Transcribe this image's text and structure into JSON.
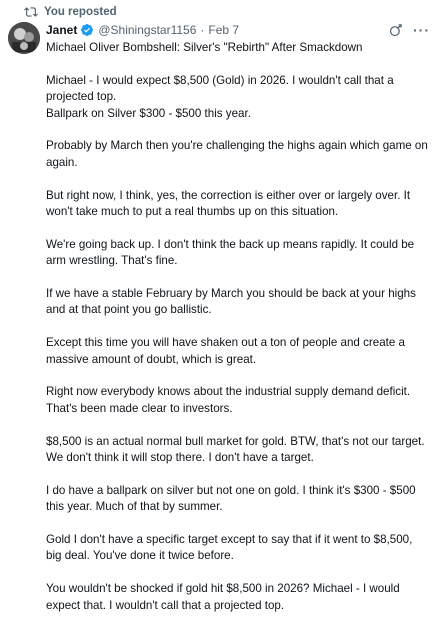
{
  "repost": {
    "label": "You reposted"
  },
  "icons": {
    "repost": "repost-icon",
    "verified": "verified-badge-icon",
    "grok": "grok-icon",
    "more": "more-icon",
    "verified_color": "#1d9bf0"
  },
  "author": {
    "name": "Janet",
    "handle": "@Shiningstar1156",
    "separator": "·",
    "date": "Feb 7"
  },
  "more_label": "···",
  "post": {
    "title": "Michael Oliver Bombshell: Silver's \"Rebirth\" After Smackdown",
    "paragraphs": [
      [
        "Michael - I would expect $8,500 (Gold) in 2026. I wouldn't call that a projected top.",
        "Ballpark on Silver $300 - $500 this year."
      ],
      [
        "Probably by March then you're challenging the highs again which game on again."
      ],
      [
        "But right now, I think, yes, the correction is either over or largely over. It won't take much to put a real thumbs up on this situation."
      ],
      [
        "We're going back up. I don't think the back up means rapidly. It could be arm wrestling. That's fine."
      ],
      [
        "If we have a stable February by March you should be back at your highs and at that point you go ballistic."
      ],
      [
        "Except this time you will have shaken out a ton of people and create a massive amount of doubt, which is great."
      ],
      [
        "Right now everybody knows about the industrial supply demand deficit. That's been made clear to investors."
      ],
      [
        "$8,500 is an actual normal bull market for gold. BTW, that's not our target. We don't think it will stop there. I don't have a target."
      ],
      [
        "I do have a ballpark on silver but not one on gold. I think it's $300 - $500 this year. Much of that by summer."
      ],
      [
        "Gold I don't have a specific target except to say that if it went to $8,500, big deal. You've done it twice before."
      ],
      [
        "You wouldn't be shocked if gold hit $8,500 in 2026? Michael - I would expect that. I wouldn't call that a projected top."
      ]
    ]
  }
}
